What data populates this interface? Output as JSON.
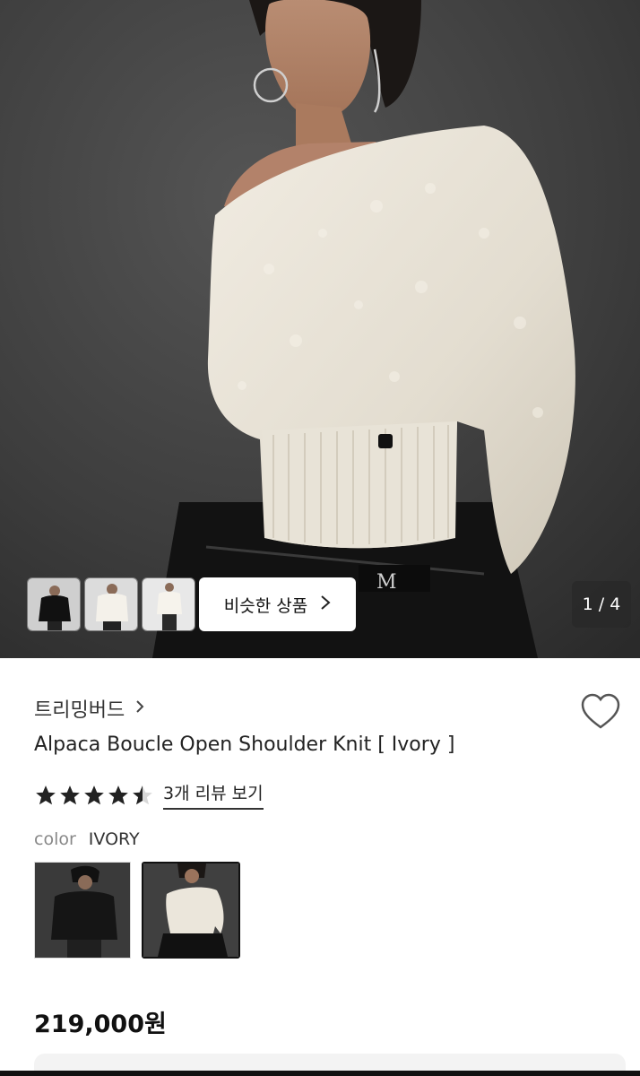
{
  "gallery": {
    "counter": "1 / 4",
    "similar_button_label": "비슷한 상품",
    "thumbnails": [
      "thumb-black-knit",
      "thumb-white-knit-front",
      "thumb-white-knit-full"
    ]
  },
  "product": {
    "brand": "트리밍버드",
    "title": "Alpaca Boucle Open Shoulder Knit [ Ivory ]",
    "rating": 4.5,
    "review_link": "3개 리뷰 보기",
    "color_label": "color",
    "color_value": "IVORY",
    "swatches": [
      "black",
      "ivory"
    ],
    "selected_swatch": "ivory",
    "price": "219,000원"
  },
  "colors": {
    "star": "#222222",
    "hero_bg": "#3e3e3e",
    "sweater": "#e6e1d6",
    "selected_border": "#111111"
  },
  "icons": {
    "brand_chevron": "chevron-right-icon",
    "similar_chevron": "chevron-right-icon",
    "wishlist": "heart-outline-icon",
    "star": "star-icon"
  }
}
